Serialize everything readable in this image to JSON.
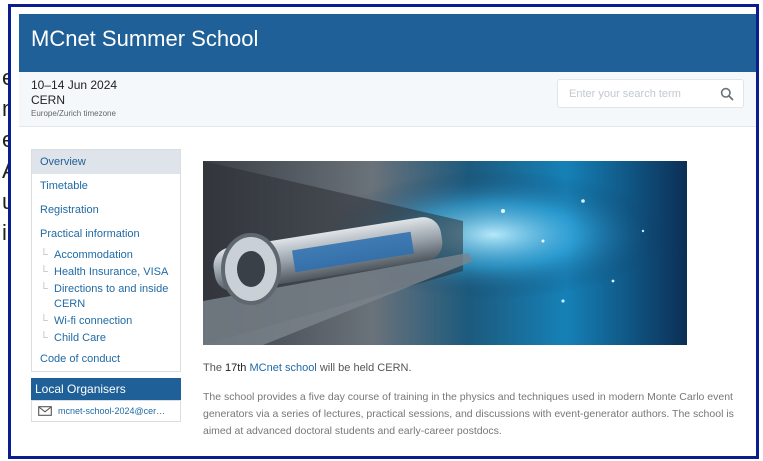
{
  "header": {
    "title": "MCnet Summer School"
  },
  "event": {
    "dates": "10–14 Jun 2024",
    "venue": "CERN",
    "timezone": "Europe/Zurich timezone"
  },
  "search": {
    "placeholder": "Enter your search term",
    "icon": "search-icon"
  },
  "sidebar": {
    "items": [
      {
        "label": "Overview",
        "active": true
      },
      {
        "label": "Timetable"
      },
      {
        "label": "Registration"
      },
      {
        "label": "Practical information"
      }
    ],
    "subitems": [
      {
        "label": "Accommodation"
      },
      {
        "label": "Health Insurance, VISA"
      },
      {
        "label": "Directions to and inside CERN"
      },
      {
        "label": "Wi-fi connection"
      },
      {
        "label": "Child Care"
      }
    ],
    "last_item": "Code of conduct"
  },
  "organisers": {
    "title": "Local Organisers",
    "email": "mcnet-school-2024@cer…",
    "icon": "envelope-icon"
  },
  "content": {
    "intro_pre": "The ",
    "intro_num": "17th",
    "intro_link": "MCnet school",
    "intro_post": " will be held CERN.",
    "description": "The school provides a five day course of training in the physics and techniques used in modern Monte Carlo event generators via a series of lectures, practical sessions, and discussions with event-generator authors. The school is aimed at advanced doctoral students and early-career postdocs."
  },
  "background_fragments": [
    "e",
    "m",
    "e",
    "A",
    "u",
    "i"
  ]
}
